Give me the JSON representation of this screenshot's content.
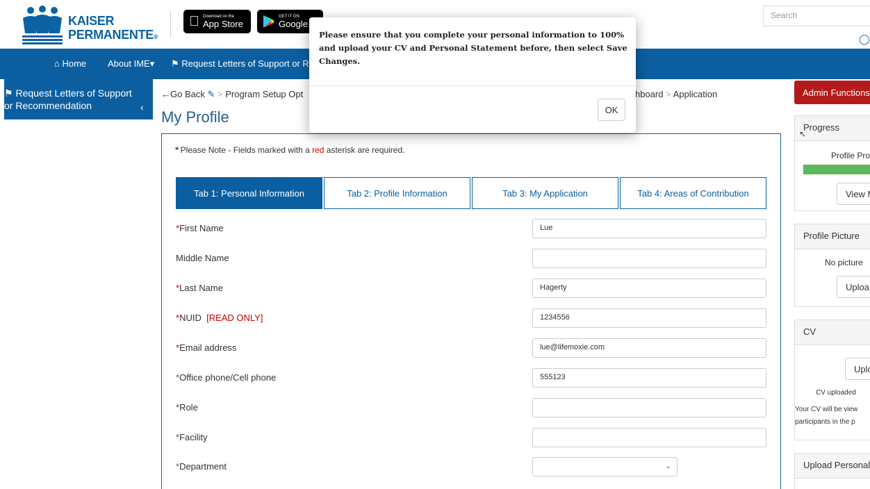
{
  "header": {
    "logo_line1": "KAISER",
    "logo_line2": "PERMANENTE",
    "logo_reg": "®",
    "app_store_small": "Download on the",
    "app_store_big": "App Store",
    "google_play_small": "GET IT ON",
    "google_play_big": "Google P",
    "search_placeholder": "Search"
  },
  "nav": {
    "home": "Home",
    "about": "About IME",
    "request": "Request Letters of Support or Re"
  },
  "sidebar": {
    "line1": "Request Letters of Support",
    "line2": "or Recommendation"
  },
  "breadcrumb": {
    "go_back": "Go Back",
    "program_setup": "Program Setup Opt",
    "dashboard": "hboard",
    "application": "Application"
  },
  "page_title": "My Profile",
  "note": {
    "prefix": "* Please Note - Fields marked with a ",
    "red_word": "red",
    "suffix": " asterisk are required."
  },
  "tabs": [
    {
      "label": "Tab 1: Personal Information"
    },
    {
      "label": "Tab 2: Profile Information"
    },
    {
      "label": "Tab 3: My Application"
    },
    {
      "label": "Tab 4: Areas of Contribution"
    }
  ],
  "form": {
    "first_name": {
      "label": "First Name",
      "value": "Lue"
    },
    "middle_name": {
      "label": "Middle Name",
      "value": ""
    },
    "last_name": {
      "label": "Last Name",
      "value": "Hagerty"
    },
    "nuid": {
      "label": "NUID",
      "readonly": "[READ ONLY]",
      "value": "1234556"
    },
    "email": {
      "label": "Email address",
      "value": "lue@lifemoxie.com"
    },
    "phone": {
      "label": "Office phone/Cell phone",
      "value": "555123"
    },
    "role": {
      "label": "Role",
      "value": ""
    },
    "facility": {
      "label": "Facility",
      "value": ""
    },
    "department": {
      "label": "Department",
      "value": ""
    }
  },
  "right": {
    "admin": "Admin Functions",
    "progress_title": "Progress",
    "profile_progress": "Profile Pro",
    "progress_value": 1.0,
    "view_btn": "View M",
    "profile_picture_title": "Profile Picture",
    "no_picture": "No picture",
    "upload_pic_btn": "Uploa",
    "cv_title": "CV",
    "upload_cv_btn": "Uplo",
    "cv_uploaded": "CV uploaded",
    "cv_note1": "Your CV will be view",
    "cv_note2": "participants in the p",
    "upload_personal_title": "Upload Personal"
  },
  "modal": {
    "message": "Please ensure that you complete your personal information to 100% and upload your CV and Personal Statement before, then select Save Changes.",
    "ok": "OK"
  },
  "colors": {
    "brand_blue": "#0b5fa1",
    "admin_red": "#b31b1b",
    "progress_green": "#5cb85c"
  }
}
